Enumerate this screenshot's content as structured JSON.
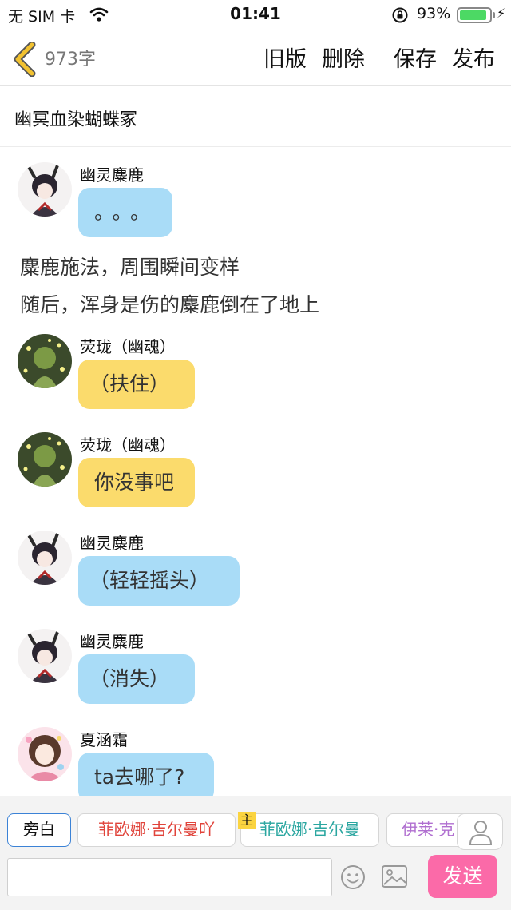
{
  "status": {
    "carrier": "无 SIM 卡",
    "time": "01:41",
    "battery_percent": "93%",
    "battery_level": 0.93
  },
  "nav": {
    "word_count": "973字",
    "old_version": "旧版",
    "delete": "删除",
    "save": "保存",
    "publish": "发布"
  },
  "story": {
    "title": "幽冥血染蝴蝶冢"
  },
  "messages": [
    {
      "type": "chat",
      "name": "幽灵麋鹿",
      "text": "。。。",
      "bubble": "blue",
      "avatar": "deer-avatar"
    },
    {
      "type": "narration",
      "text": "麋鹿施法，周围瞬间变样"
    },
    {
      "type": "narration",
      "text": "随后，浑身是伤的麋鹿倒在了地上"
    },
    {
      "type": "chat",
      "name": "荧珑（幽魂）",
      "text": "（扶住）",
      "bubble": "yellow",
      "avatar": "firefly-avatar"
    },
    {
      "type": "chat",
      "name": "荧珑（幽魂）",
      "text": "你没事吧",
      "bubble": "yellow",
      "avatar": "firefly-avatar"
    },
    {
      "type": "chat",
      "name": "幽灵麋鹿",
      "text": "（轻轻摇头）",
      "bubble": "blue",
      "avatar": "deer-avatar"
    },
    {
      "type": "chat",
      "name": "幽灵麋鹿",
      "text": "（消失）",
      "bubble": "blue",
      "avatar": "deer-avatar"
    },
    {
      "type": "chat",
      "name": "夏涵霜",
      "text": "ta去哪了?",
      "bubble": "blue",
      "avatar": "girl-avatar"
    }
  ],
  "roles": {
    "narrator": "旁白",
    "chips": [
      "菲欧娜·吉尔曼吖",
      "菲欧娜·吉尔曼",
      "伊莱·克"
    ],
    "host_tag": "主"
  },
  "input": {
    "value": "",
    "send": "发送"
  },
  "colors": {
    "blue_bubble": "#a9dcf7",
    "yellow_bubble": "#fbdb6c",
    "send_button": "#fb6aa8",
    "back_arrow": "#f2c230"
  }
}
